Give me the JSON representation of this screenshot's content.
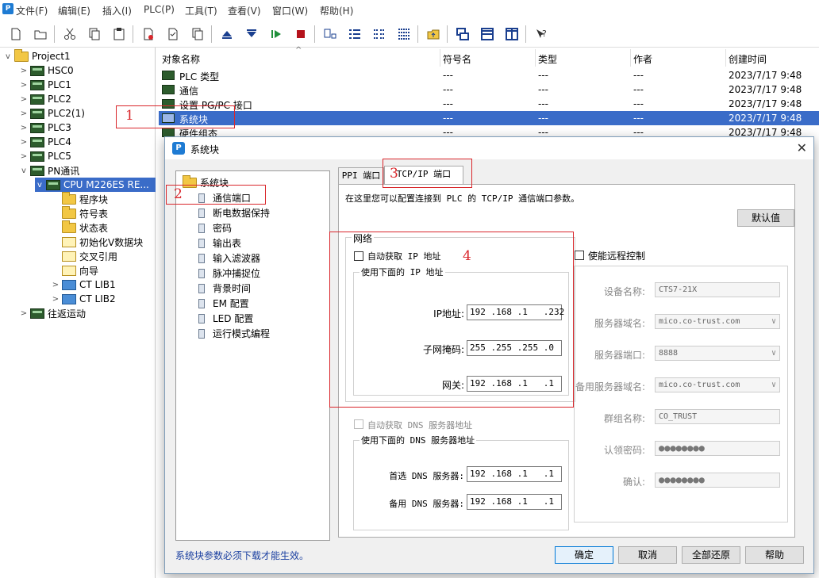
{
  "menu": [
    "文件(F)",
    "编辑(E)",
    "插入(I)",
    "PLC(P)",
    "工具(T)",
    "查看(V)",
    "窗口(W)",
    "帮助(H)"
  ],
  "toolbar_icons": [
    "new-file-icon",
    "open-folder-icon",
    "cut-icon",
    "copy-icon",
    "paste-icon",
    "download-icon",
    "compare-icon",
    "upload-icon",
    "arrow-up-icon",
    "arrow-down-icon",
    "run-icon",
    "stop-icon",
    "monitor-icon",
    "list-icon",
    "list-detail-icon",
    "list-grid-icon",
    "open-project-icon",
    "windows-icon",
    "split-h-icon",
    "split-v-icon",
    "context-help-icon"
  ],
  "tree": {
    "root": "Project1",
    "items": [
      {
        "label": "HSC0",
        "icon": "plc",
        "depth": 1,
        "arrow": ">"
      },
      {
        "label": "PLC1",
        "icon": "plc",
        "depth": 1,
        "arrow": ">"
      },
      {
        "label": "PLC2",
        "icon": "plc",
        "depth": 1,
        "arrow": ">"
      },
      {
        "label": "PLC2(1)",
        "icon": "plc",
        "depth": 1,
        "arrow": ">"
      },
      {
        "label": "PLC3",
        "icon": "plc",
        "depth": 1,
        "arrow": ">"
      },
      {
        "label": "PLC4",
        "icon": "plc",
        "depth": 1,
        "arrow": ">"
      },
      {
        "label": "PLC5",
        "icon": "plc",
        "depth": 1,
        "arrow": ">"
      },
      {
        "label": "PN通讯",
        "icon": "plc",
        "depth": 1,
        "arrow": "v"
      },
      {
        "label": "CPU M226ES RE...",
        "icon": "cpu",
        "depth": 2,
        "arrow": "v",
        "selected": true
      },
      {
        "label": "程序块",
        "icon": "folder",
        "depth": 3,
        "arrow": ""
      },
      {
        "label": "符号表",
        "icon": "folder",
        "depth": 3,
        "arrow": ""
      },
      {
        "label": "状态表",
        "icon": "folder",
        "depth": 3,
        "arrow": ""
      },
      {
        "label": "初始化V数据块",
        "icon": "cfg",
        "depth": 3,
        "arrow": ""
      },
      {
        "label": "交叉引用",
        "icon": "cfg",
        "depth": 3,
        "arrow": ""
      },
      {
        "label": "向导",
        "icon": "cfg",
        "depth": 3,
        "arrow": ""
      },
      {
        "label": "CT LIB1",
        "icon": "lib",
        "depth": 3,
        "arrow": ">"
      },
      {
        "label": "CT LIB2",
        "icon": "lib",
        "depth": 3,
        "arrow": ">"
      },
      {
        "label": "往返运动",
        "icon": "plc",
        "depth": 1,
        "arrow": ">"
      }
    ]
  },
  "list": {
    "headers": [
      "对象名称",
      "符号名",
      "类型",
      "作者",
      "创建时间"
    ],
    "rows": [
      {
        "name": "PLC 类型",
        "sym": "---",
        "type": "---",
        "author": "---",
        "time": "2023/7/17 9:48"
      },
      {
        "name": "通信",
        "sym": "---",
        "type": "---",
        "author": "---",
        "time": "2023/7/17 9:48"
      },
      {
        "name": "设置 PG/PC 接口",
        "sym": "---",
        "type": "---",
        "author": "---",
        "time": "2023/7/17 9:48"
      },
      {
        "name": "系统块",
        "sym": "---",
        "type": "---",
        "author": "---",
        "time": "2023/7/17 9:48",
        "selected": true
      },
      {
        "name": "硬件组态",
        "sym": "---",
        "type": "---",
        "author": "---",
        "time": "2023/7/17 9:48"
      }
    ]
  },
  "dialog": {
    "title": "系统块",
    "close": "✕",
    "nav_root": "系统块",
    "nav_items": [
      "通信端口",
      "断电数据保持",
      "密码",
      "输出表",
      "输入滤波器",
      "脉冲捕捉位",
      "背景时间",
      "EM 配置",
      "LED 配置",
      "运行模式编程"
    ],
    "tabs": [
      "PPI 端口",
      "TCP/IP 端口"
    ],
    "description": "在这里您可以配置连接到 PLC 的 TCP/IP 通信端口参数。",
    "default_btn": "默认值",
    "network": {
      "group_label": "网络",
      "auto_ip": "自动获取 IP 地址",
      "use_ip": "使用下面的 IP 地址",
      "ip_label": "IP地址:",
      "ip": "192 .168 .1   .232",
      "mask_label": "子网掩码:",
      "mask": "255 .255 .255 .0",
      "gw_label": "网关:",
      "gw": "192 .168 .1   .1",
      "auto_dns": "自动获取 DNS 服务器地址",
      "use_dns": "使用下面的 DNS 服务器地址",
      "dns1_label": "首选 DNS 服务器:",
      "dns1": "192 .168 .1   .1",
      "dns2_label": "备用 DNS 服务器:",
      "dns2": "192 .168 .1   .1"
    },
    "remote": {
      "enable": "使能远程控制",
      "device_label": "设备名称:",
      "device": "CTS7-21X",
      "server_label": "服务器域名:",
      "server": "mico.co-trust.com",
      "port_label": "服务器端口:",
      "port": "8888",
      "backup_label": "备用服务器域名:",
      "backup": "mico.co-trust.com",
      "group_label": "群组名称:",
      "group": "CO_TRUST",
      "auth_label": "认领密码:",
      "auth": "●●●●●●●●",
      "confirm_label": "确认:",
      "confirm": "●●●●●●●●"
    },
    "footer_note": "系统块参数必须下载才能生效。",
    "buttons": {
      "ok": "确定",
      "cancel": "取消",
      "restore": "全部还原",
      "help": "帮助"
    }
  },
  "annotations": [
    "1",
    "2",
    "3",
    "4"
  ],
  "colors": {
    "selection": "#3a6cc8",
    "annotation": "#d9262b",
    "accent": "#0078d7"
  }
}
